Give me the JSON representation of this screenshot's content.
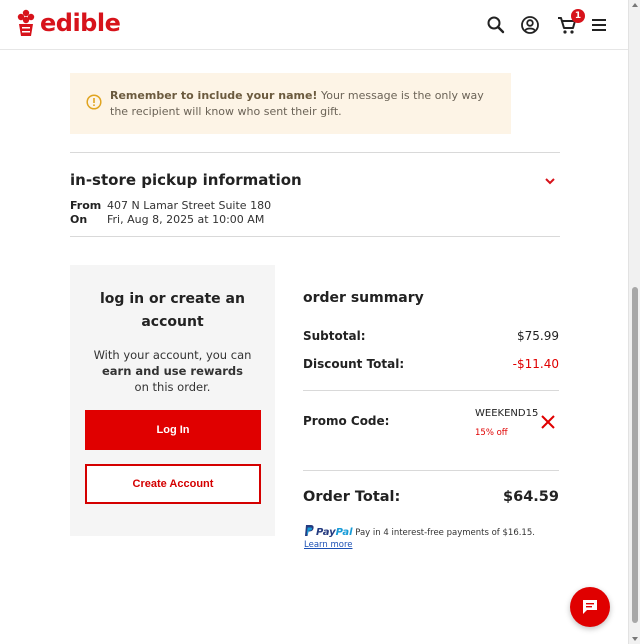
{
  "header": {
    "logo_text": "edible",
    "cart_count": "1",
    "icons": [
      "search-icon",
      "account-icon",
      "cart-icon",
      "menu-icon"
    ],
    "brand_color": "#d7131b"
  },
  "notice": {
    "bold_text": "Remember to include your name!",
    "text": " Your message is the only way the recipient will know who sent their gift.",
    "background": "#fdf4e6"
  },
  "pickup": {
    "title": "in-store pickup information",
    "from_label": "From",
    "from_value": "407 N Lamar Street Suite 180",
    "on_label": "On",
    "on_value": "Fri, Aug 8, 2025 at 10:00 AM"
  },
  "login": {
    "title": "log in or create an account",
    "desc_1": "With your account, you can",
    "desc_bold": "earn and use rewards",
    "desc_2": "on this order.",
    "login_button": "Log In",
    "create_button": "Create Account"
  },
  "summary": {
    "title": "order summary",
    "subtotal_label": "Subtotal:",
    "subtotal_value": "$75.99",
    "discount_label": "Discount Total:",
    "discount_value": "-$11.40",
    "promo_label": "Promo Code:",
    "promo_code": "WEEKEND15",
    "promo_desc": "15% off",
    "total_label": "Order Total:",
    "total_value": "$64.59"
  },
  "paypal": {
    "logo_pay": "Pay",
    "logo_pal": "Pal",
    "text": " Pay in 4 interest-free payments of $16.15.",
    "learn_more": "Learn more"
  }
}
